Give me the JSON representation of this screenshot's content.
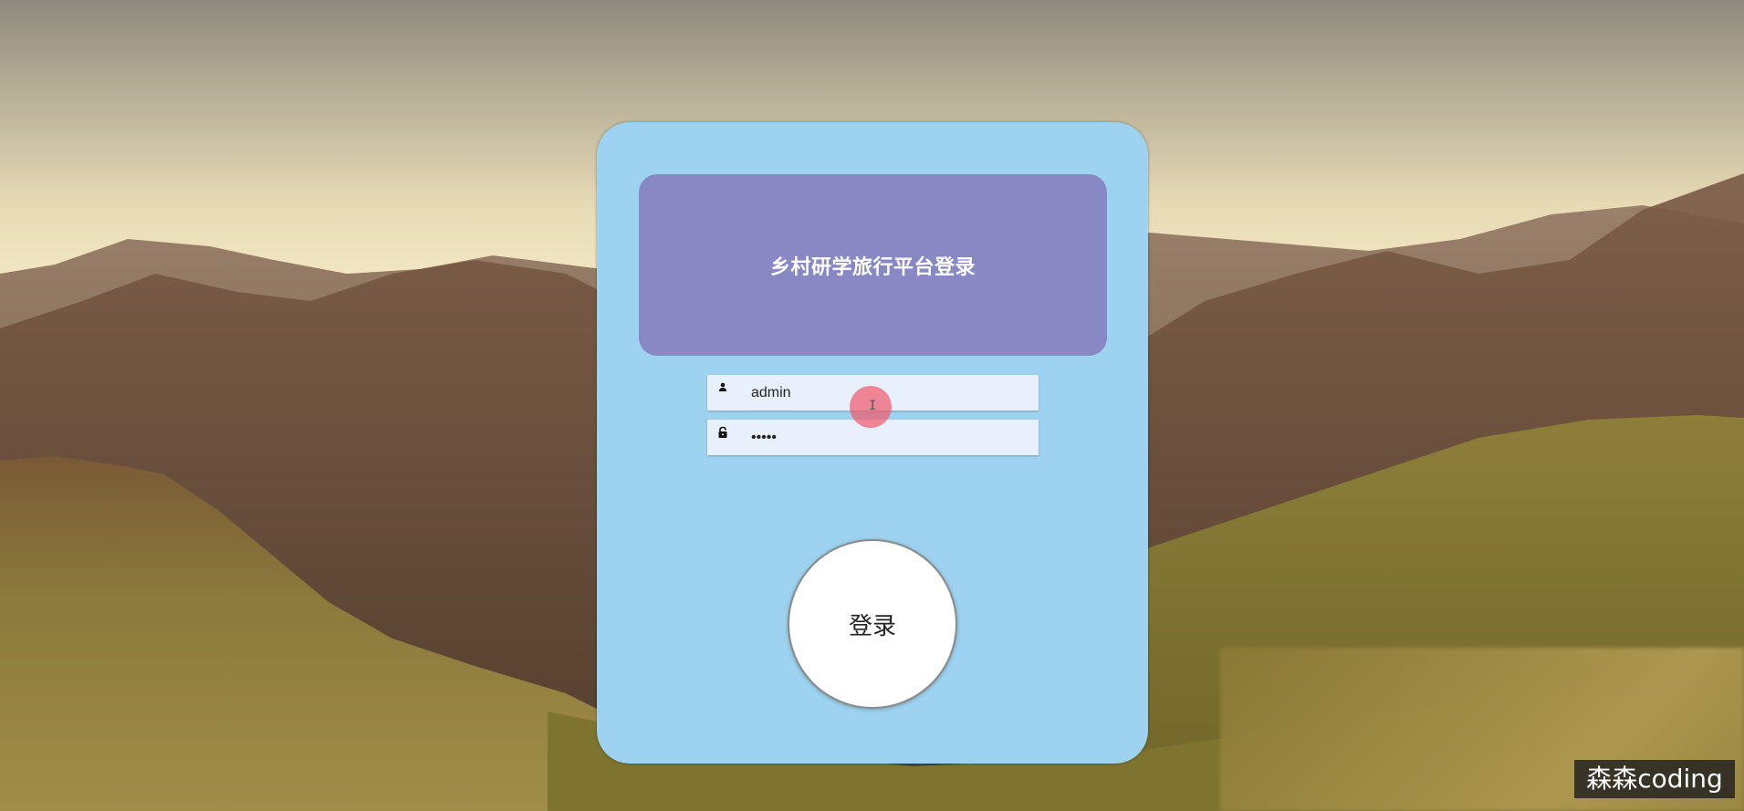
{
  "login": {
    "title": "乡村研学旅行平台登录",
    "username_value": "admin",
    "password_value": "•••••",
    "submit_label": "登录"
  },
  "watermark": "森森coding",
  "colors": {
    "card_bg": "#9dd3f0",
    "title_panel_bg": "#8888c4",
    "input_bg": "#e8f0fe",
    "button_bg": "#ffffff",
    "cursor_highlight": "#f05a6e"
  },
  "icons": {
    "username": "user-icon",
    "password": "lock-icon"
  }
}
